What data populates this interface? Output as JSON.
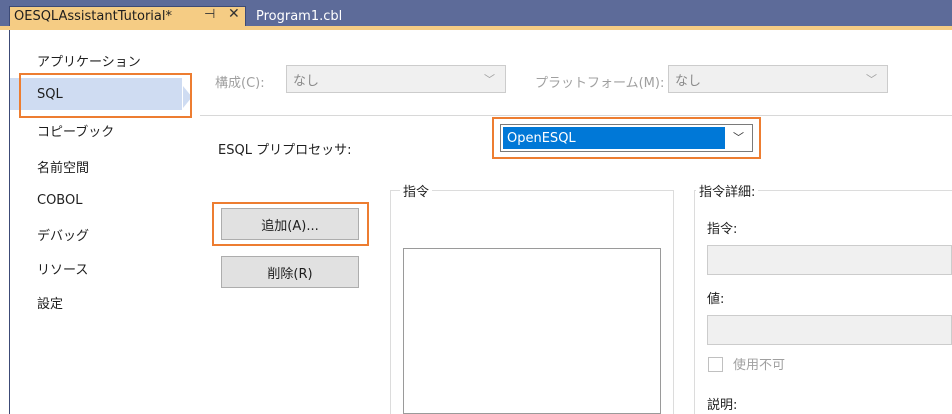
{
  "tabs": {
    "active": {
      "label": "OESQLAssistantTutorial*",
      "pin_icon": "pin-icon",
      "close_icon": "close-icon"
    },
    "inactive": {
      "label": "Program1.cbl"
    }
  },
  "sidebar": {
    "items": [
      {
        "label": "アプリケーション"
      },
      {
        "label": "SQL",
        "selected": true
      },
      {
        "label": "コピーブック"
      },
      {
        "label": "名前空間"
      },
      {
        "label": "COBOL"
      },
      {
        "label": "デバッグ"
      },
      {
        "label": "リソース"
      },
      {
        "label": "設定"
      }
    ]
  },
  "config": {
    "config_label": "構成(C):",
    "config_value": "なし",
    "platform_label": "プラットフォーム(M):",
    "platform_value": "なし"
  },
  "esql": {
    "label": "ESQL プリプロセッサ:",
    "value": "OpenESQL"
  },
  "buttons": {
    "add": "追加(A)...",
    "delete": "削除(R)"
  },
  "directives": {
    "group_title": "指令",
    "details_title": "指令詳細:",
    "directive_label": "指令:",
    "value_label": "値:",
    "disabled_label": "使用不可",
    "description_label": "説明:"
  },
  "colors": {
    "highlight": "#ed7d31",
    "selection": "#0078d7",
    "tab_active": "#f5cc84",
    "tab_bar": "#5d6b99"
  }
}
